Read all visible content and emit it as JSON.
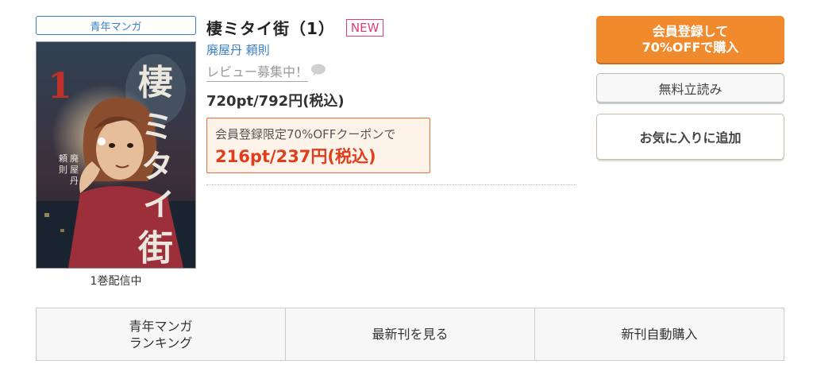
{
  "genre_tag": "青年マンガ",
  "volumes_label": "1巻配信中",
  "product": {
    "title": "棲ミタイ街（1）",
    "new_badge": "NEW",
    "author": "廃屋丹 頼則",
    "review_link": "レビュー募集中！",
    "price": "720pt/792円(税込)"
  },
  "coupon": {
    "label": "会員登録限定70%OFFクーポンで",
    "price": "216pt/237円(税込)"
  },
  "buttons": {
    "buy": "会員登録して\n70%OFFで購入",
    "free_read": "無料立読み",
    "favorite": "お気に入りに追加"
  },
  "bottom_nav": [
    {
      "label": "青年マンガ\nランキング"
    },
    {
      "label": "最新刊を見る"
    },
    {
      "label": "新刊自動購入"
    }
  ],
  "cover": {
    "volume_number": "1",
    "title_chars": "棲ミタイ街",
    "author_chars": "廃屋丹 頼則",
    "colors": {
      "background": "#2b3a4a",
      "title": "#e8e4dc",
      "number": "#c0302a"
    }
  },
  "icons": {
    "review": "speech-bubble-icon"
  },
  "colors": {
    "accent_blue": "#3a7fc6",
    "new_pink": "#e23c78",
    "buy_orange": "#f1892d",
    "coupon_red": "#e03d1d"
  }
}
